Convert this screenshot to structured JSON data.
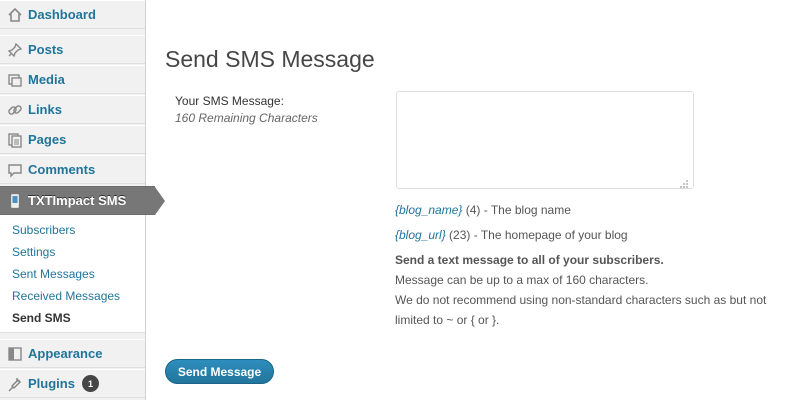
{
  "sidebar": {
    "menu": [
      {
        "label": "Dashboard",
        "icon": "dashboard-icon"
      },
      {
        "label": "Posts",
        "icon": "pin-icon"
      },
      {
        "label": "Media",
        "icon": "media-icon"
      },
      {
        "label": "Links",
        "icon": "link-icon"
      },
      {
        "label": "Pages",
        "icon": "pages-icon"
      },
      {
        "label": "Comments",
        "icon": "comment-icon"
      },
      {
        "label": "TXTImpact SMS",
        "icon": "phone-icon"
      },
      {
        "label": "Appearance",
        "icon": "appearance-icon"
      },
      {
        "label": "Plugins",
        "icon": "plug-icon",
        "badge": "1"
      }
    ],
    "submenu": [
      "Subscribers",
      "Settings",
      "Sent Messages",
      "Received Messages",
      "Send SMS"
    ]
  },
  "main": {
    "title": "Send SMS Message",
    "field_label": "Your SMS Message:",
    "remaining": "160 Remaining Characters",
    "textarea_value": "",
    "tags": [
      {
        "tag": "{blog_name}",
        "rest": " (4) - The blog name"
      },
      {
        "tag": "{blog_url}",
        "rest": " (23) - The homepage of your blog"
      }
    ],
    "desc_bold": "Send a text message to all of your subscribers.",
    "desc_lines": [
      "Message can be up to a max of 160 characters.",
      "We do not recommend using non-standard characters such as but not",
      "limited to ~ or { or }."
    ],
    "button_label": "Send Message"
  },
  "colors": {
    "link": "#21759b",
    "current_menu": "#777777",
    "button": "#21759b"
  }
}
